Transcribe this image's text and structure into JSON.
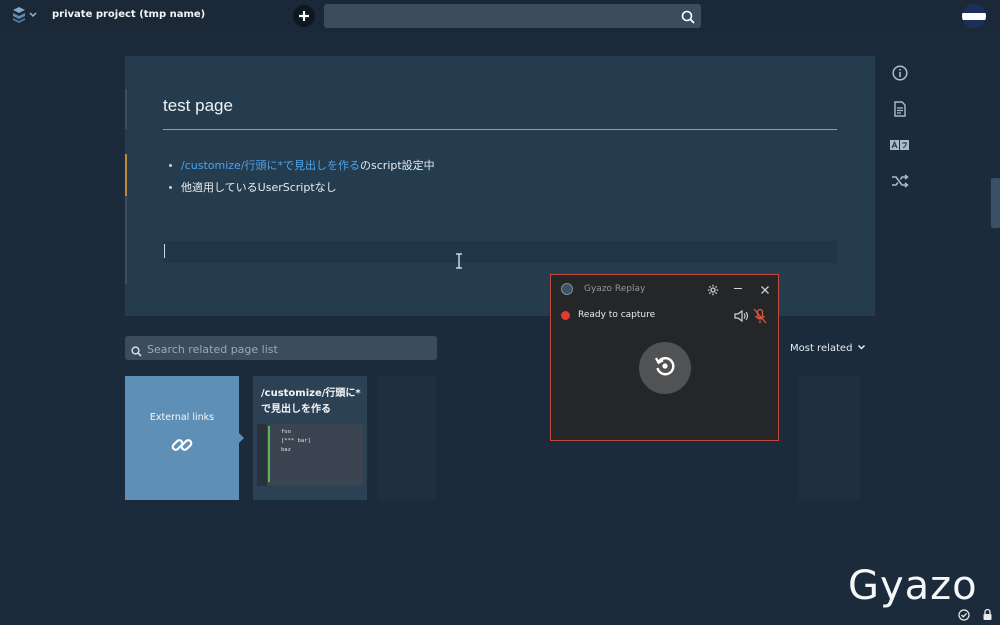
{
  "navbar": {
    "project_title": "private project (tmp name)",
    "search_placeholder": "",
    "new_page_icon": "plus-icon",
    "search_icon": "search-icon",
    "brand_icon": "scrapbox-logo-icon"
  },
  "page": {
    "title": "test page",
    "lines": [
      {
        "link": "/customize/行頭に*で見出しを作る",
        "text": "のscript設定中"
      },
      {
        "link": "",
        "text": "他適用しているUserScriptなし"
      }
    ]
  },
  "sidebar_icons": [
    "info-icon",
    "document-icon",
    "translate-icon",
    "shuffle-icon"
  ],
  "related": {
    "search_placeholder": "Search related page list",
    "sort_label": "Most related",
    "cards": [
      {
        "type": "external",
        "label": "External links",
        "icon": "link-icon"
      },
      {
        "type": "page",
        "title": "/customize/行頭に*で見出しを作る",
        "thumb_code": "foo\n[*** bar]\nbaz"
      }
    ]
  },
  "gyazo": {
    "title": "Gyazo Replay",
    "status": "Ready to capture",
    "watermark": "Gyazo"
  },
  "colors": {
    "background": "#1c2b3b",
    "page_bg": "#253c4e",
    "link": "#4ea3ea",
    "external_card": "#5e8fb7",
    "record_red": "#e23b2e"
  }
}
